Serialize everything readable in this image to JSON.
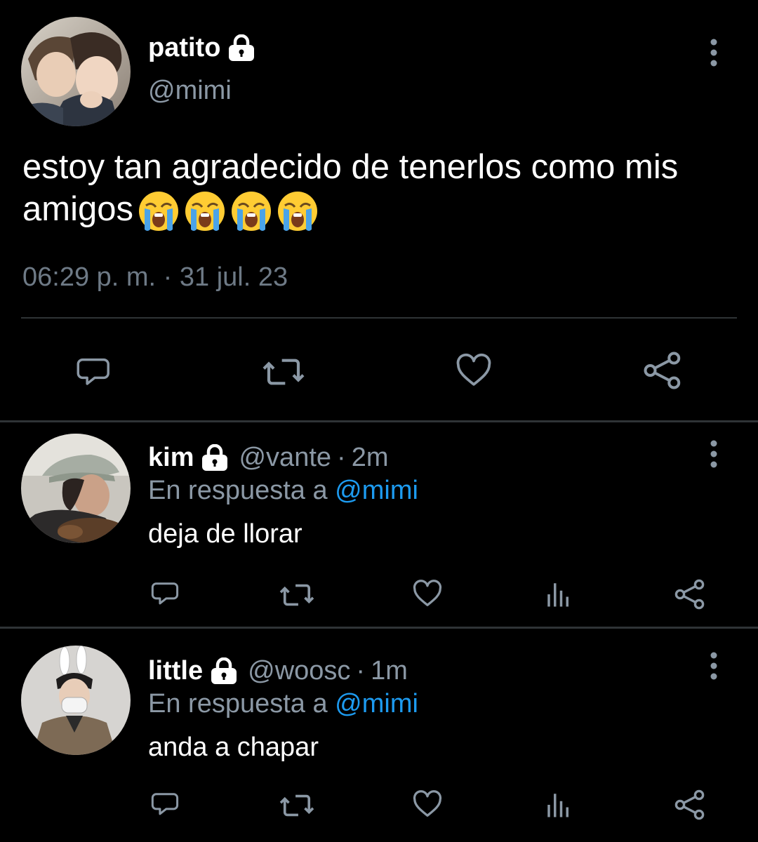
{
  "main_tweet": {
    "display_name": "patito",
    "handle": "@mimi",
    "text": "estoy tan agradecido de tenerlos como mis amigos",
    "emojis": [
      "loudly-crying-face-emoji",
      "loudly-crying-face-emoji",
      "loudly-crying-face-emoji",
      "loudly-crying-face-emoji"
    ],
    "timestamp": "06:29 p. m. · 31 jul. 23",
    "actions": [
      "reply-icon",
      "retweet-icon",
      "like-icon",
      "share-icon"
    ]
  },
  "replies": [
    {
      "display_name": "kim",
      "handle": "@vante",
      "separator": "·",
      "time": "2m",
      "context_prefix": "En respuesta a",
      "context_mention": "@mimi",
      "text": "deja de llorar",
      "actions": [
        "reply-icon",
        "retweet-icon",
        "like-icon",
        "analytics-icon",
        "share-icon"
      ]
    },
    {
      "display_name": "little",
      "handle": "@woosc",
      "separator": "·",
      "time": "1m",
      "context_prefix": "En respuesta a",
      "context_mention": "@mimi",
      "text": "anda a chapar",
      "actions": [
        "reply-icon",
        "retweet-icon",
        "like-icon",
        "analytics-icon",
        "share-icon"
      ]
    }
  ],
  "colors": {
    "background": "#000000",
    "primary_text": "#ffffff",
    "secondary_text": "#8b98a5",
    "icon": "#8b98a5",
    "mention": "#1d9bf0",
    "divider": "#2f3336"
  }
}
